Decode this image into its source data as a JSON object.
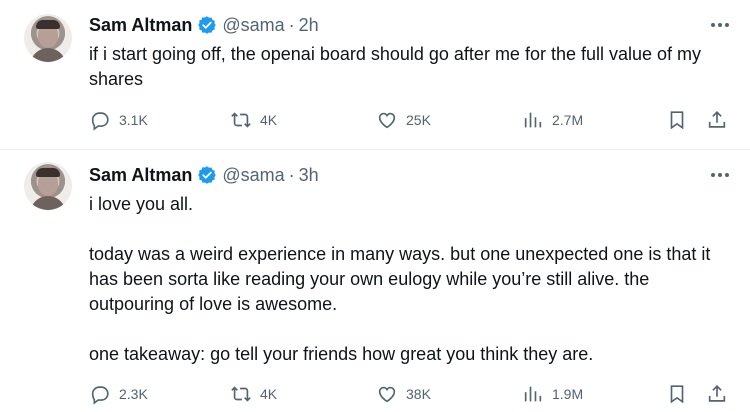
{
  "tweets": [
    {
      "author": {
        "name": "Sam Altman",
        "handle": "@sama",
        "separator": "·",
        "time": "2h"
      },
      "paragraphs": [
        "if i start going off, the openai board should go after me for the full value of my shares"
      ],
      "stats": {
        "replies": "3.1K",
        "retweets": "4K",
        "likes": "25K",
        "views": "2.7M"
      }
    },
    {
      "author": {
        "name": "Sam Altman",
        "handle": "@sama",
        "separator": "·",
        "time": "3h"
      },
      "paragraphs": [
        "i love you all.",
        "today was a weird experience in many ways. but one unexpected one is that it has been sorta like reading your own eulogy while you’re still alive. the outpouring of love is awesome.",
        "one takeaway: go tell your friends how great you think they are."
      ],
      "stats": {
        "replies": "2.3K",
        "retweets": "4K",
        "likes": "38K",
        "views": "1.9M"
      }
    }
  ],
  "icons": {
    "verified": "verified-badge-icon",
    "more": "more-options-icon",
    "reply": "reply-icon",
    "retweet": "retweet-icon",
    "like": "heart-icon",
    "views": "views-icon",
    "bookmark": "bookmark-icon",
    "share": "share-icon"
  },
  "colors": {
    "verified": "#1d9bf0",
    "text": "#0f1419",
    "muted": "#536471",
    "divider": "#eff3f4"
  }
}
